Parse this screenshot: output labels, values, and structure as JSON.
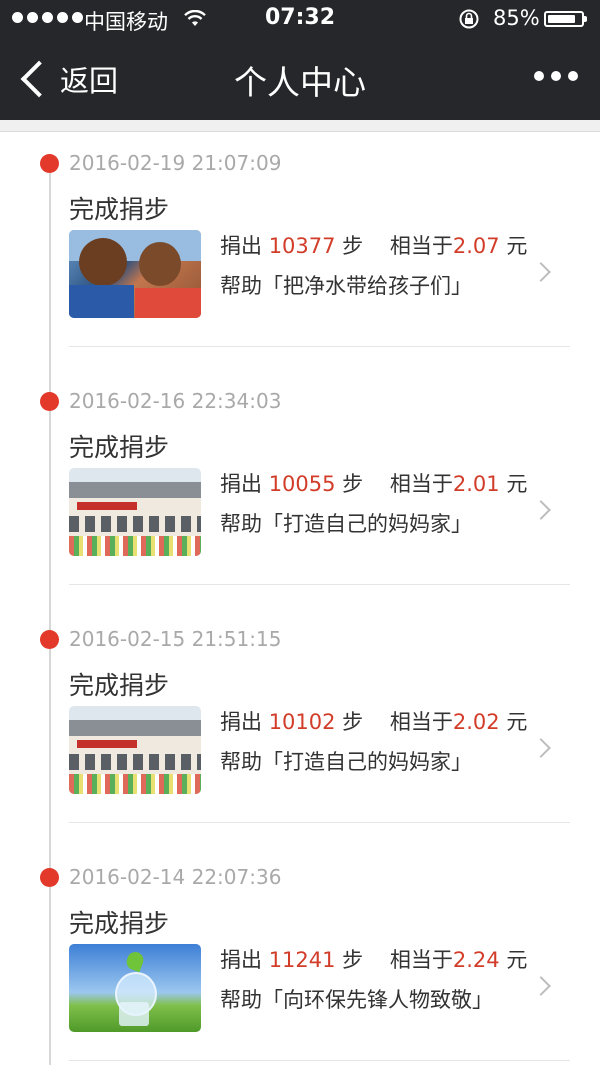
{
  "status_bar": {
    "carrier": "中国移动",
    "time": "07:32",
    "battery_pct": "85%",
    "battery_level": 0.85
  },
  "nav": {
    "back_label": "返回",
    "title": "个人中心"
  },
  "entries": [
    {
      "timestamp": "2016-02-19 21:07:09",
      "action": "完成捐步",
      "donate_prefix": "捐出 ",
      "steps": "10377",
      "steps_unit": " 步",
      "equiv_prefix": "    相当于",
      "amount": "2.07",
      "amount_unit": " 元",
      "help_text": "帮助「把净水带给孩子们」",
      "image": "children-drinking-water"
    },
    {
      "timestamp": "2016-02-16 22:34:03",
      "action": "完成捐步",
      "donate_prefix": "捐出 ",
      "steps": "10055",
      "steps_unit": " 步",
      "equiv_prefix": "    相当于",
      "amount": "2.01",
      "amount_unit": " 元",
      "help_text": "帮助「打造自己的妈妈家」",
      "image": "community-building"
    },
    {
      "timestamp": "2016-02-15 21:51:15",
      "action": "完成捐步",
      "donate_prefix": "捐出 ",
      "steps": "10102",
      "steps_unit": " 步",
      "equiv_prefix": "    相当于",
      "amount": "2.02",
      "amount_unit": " 元",
      "help_text": "帮助「打造自己的妈妈家」",
      "image": "community-building"
    },
    {
      "timestamp": "2016-02-14 22:07:36",
      "action": "完成捐步",
      "donate_prefix": "捐出 ",
      "steps": "11241",
      "steps_unit": " 步",
      "equiv_prefix": "    相当于",
      "amount": "2.24",
      "amount_unit": " 元",
      "help_text": "帮助「向环保先锋人物致敬」",
      "image": "eco-globe-sprout"
    }
  ],
  "colors": {
    "bar_bg": "#26272b",
    "accent_red": "#d23d2a",
    "timeline_dot": "#e2392a",
    "timestamp_gray": "#a9a9a9"
  }
}
